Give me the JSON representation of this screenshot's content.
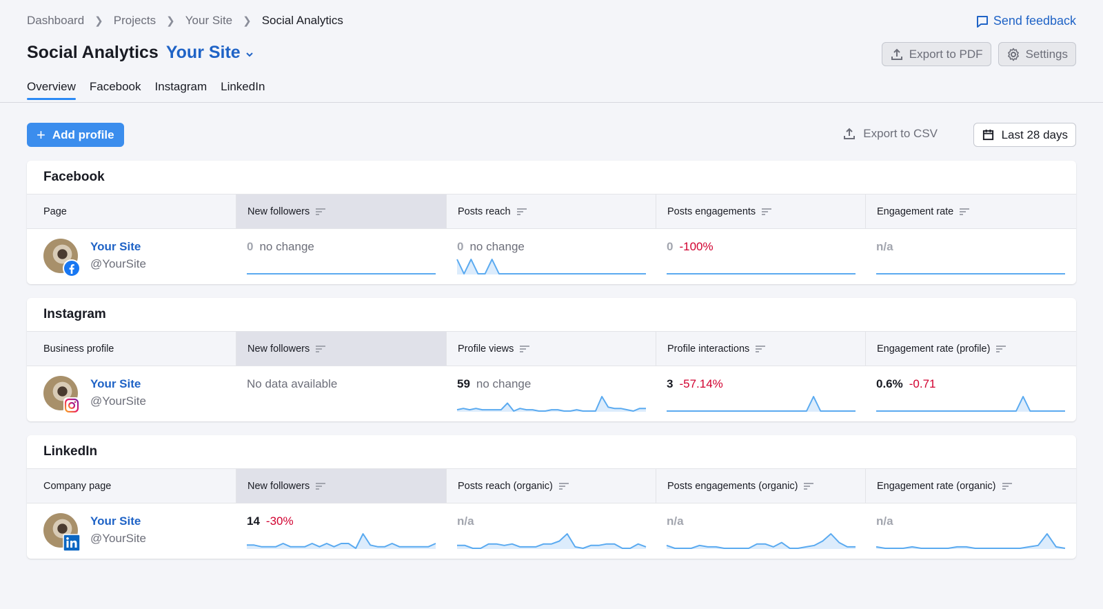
{
  "breadcrumb": [
    "Dashboard",
    "Projects",
    "Your Site",
    "Social Analytics"
  ],
  "header": {
    "title": "Social Analytics",
    "site": "Your Site",
    "send_feedback": "Send feedback",
    "export_pdf": "Export to PDF",
    "settings": "Settings"
  },
  "tabs": [
    {
      "label": "Overview",
      "active": true
    },
    {
      "label": "Facebook",
      "active": false
    },
    {
      "label": "Instagram",
      "active": false
    },
    {
      "label": "LinkedIn",
      "active": false
    }
  ],
  "toolbar": {
    "add_profile": "Add profile",
    "export_csv": "Export to CSV",
    "date_range": "Last 28 days"
  },
  "colors": {
    "accent": "#1f63c6",
    "primary_button": "#3b8ded",
    "negative": "#d1002f",
    "sparkline": "#5aaaf0",
    "sparkline_fill": "#dcecfc"
  },
  "sections": [
    {
      "title": "Facebook",
      "network": "facebook",
      "columns": [
        "Page",
        "New followers",
        "Posts reach",
        "Posts engagements",
        "Engagement rate"
      ],
      "profile": {
        "name": "Your Site",
        "handle": "@YourSite"
      },
      "metrics": [
        {
          "value": "0",
          "value_muted": true,
          "delta": "no change",
          "delta_negative": false,
          "spark": [
            0,
            0,
            0,
            0,
            0,
            0,
            0,
            0,
            0,
            0,
            0,
            0,
            0,
            0,
            0,
            0,
            0,
            0,
            0,
            0,
            0,
            0,
            0,
            0,
            0,
            0,
            0,
            0
          ]
        },
        {
          "value": "0",
          "value_muted": true,
          "delta": "no change",
          "delta_negative": false,
          "spark": [
            1,
            0,
            1,
            0,
            0,
            1,
            0,
            0,
            0,
            0,
            0,
            0,
            0,
            0,
            0,
            0,
            0,
            0,
            0,
            0,
            0,
            0,
            0,
            0,
            0,
            0,
            0,
            0
          ]
        },
        {
          "value": "0",
          "value_muted": true,
          "delta": "-100%",
          "delta_negative": true,
          "spark": [
            0,
            0,
            0,
            0,
            0,
            0,
            0,
            0,
            0,
            0,
            0,
            0,
            0,
            0,
            0,
            0,
            0,
            0,
            0,
            0,
            0,
            0,
            0,
            0,
            0,
            0,
            0,
            0
          ]
        },
        {
          "na": "n/a",
          "spark": [
            0,
            0,
            0,
            0,
            0,
            0,
            0,
            0,
            0,
            0,
            0,
            0,
            0,
            0,
            0,
            0,
            0,
            0,
            0,
            0,
            0,
            0,
            0,
            0,
            0,
            0,
            0,
            0
          ]
        }
      ]
    },
    {
      "title": "Instagram",
      "network": "instagram",
      "columns": [
        "Business profile",
        "New followers",
        "Profile views",
        "Profile interactions",
        "Engagement rate (profile)"
      ],
      "profile": {
        "name": "Your Site",
        "handle": "@YourSite"
      },
      "metrics": [
        {
          "nodata": "No data available"
        },
        {
          "value": "59",
          "delta": "no change",
          "delta_negative": false,
          "spark": [
            1,
            2,
            1,
            2,
            1,
            1,
            1,
            1,
            6,
            0,
            2,
            1,
            1,
            0,
            0,
            1,
            1,
            0,
            0,
            1,
            0,
            0,
            0,
            11,
            3,
            2,
            2,
            1,
            0,
            2,
            2
          ]
        },
        {
          "value": "3",
          "delta": "-57.14%",
          "delta_negative": true,
          "spark": [
            0,
            0,
            0,
            0,
            0,
            0,
            0,
            0,
            0,
            0,
            0,
            0,
            0,
            0,
            0,
            0,
            0,
            0,
            0,
            0,
            0,
            10,
            0,
            0,
            0,
            0,
            0,
            0
          ]
        },
        {
          "value": "0.6%",
          "delta": "-0.71",
          "delta_negative": true,
          "spark": [
            0,
            0,
            0,
            0,
            0,
            0,
            0,
            0,
            0,
            0,
            0,
            0,
            0,
            0,
            0,
            0,
            0,
            0,
            0,
            0,
            0,
            10,
            0,
            0,
            0,
            0,
            0,
            0
          ]
        }
      ]
    },
    {
      "title": "LinkedIn",
      "network": "linkedin",
      "columns": [
        "Company page",
        "New followers",
        "Posts reach (organic)",
        "Posts engagements (organic)",
        "Engagement rate (organic)"
      ],
      "profile": {
        "name": "Your Site",
        "handle": "@YourSite"
      },
      "metrics": [
        {
          "value": "14",
          "delta": "-30%",
          "delta_negative": true,
          "spark": [
            1,
            1,
            0,
            0,
            0,
            2,
            0,
            0,
            0,
            2,
            0,
            2,
            0,
            2,
            2,
            -1,
            8,
            1,
            0,
            0,
            2,
            0,
            0,
            0,
            0,
            0,
            2
          ]
        },
        {
          "na": "n/a",
          "spark": [
            2,
            2,
            0,
            0,
            3,
            3,
            2,
            3,
            1,
            1,
            1,
            3,
            3,
            5,
            10,
            1,
            0,
            2,
            2,
            3,
            3,
            0,
            0,
            3,
            1
          ]
        },
        {
          "na": "n/a",
          "spark": [
            2,
            0,
            0,
            0,
            2,
            1,
            1,
            0,
            0,
            0,
            0,
            3,
            3,
            1,
            4,
            0,
            0,
            1,
            2,
            5,
            10,
            4,
            1,
            1
          ]
        },
        {
          "na": "n/a",
          "spark": [
            1,
            0,
            0,
            0,
            1,
            0,
            0,
            0,
            0,
            1,
            1,
            0,
            0,
            0,
            0,
            0,
            0,
            1,
            2,
            10,
            1,
            0
          ]
        }
      ]
    }
  ]
}
